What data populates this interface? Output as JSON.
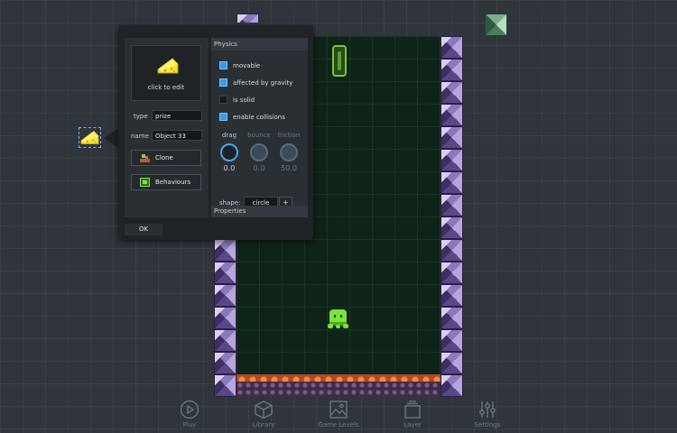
{
  "popup": {
    "edit_label": "click to edit",
    "type_label": "type",
    "type_value": "prize",
    "name_label": "name",
    "name_value": "Object 33",
    "clone_label": "Clone",
    "behaviours_label": "Behaviours",
    "ok_label": "OK",
    "physics": {
      "heading": "Physics",
      "checkboxes": [
        {
          "label": "movable",
          "checked": true
        },
        {
          "label": "affected by gravity",
          "checked": true
        },
        {
          "label": "is solid",
          "checked": false
        },
        {
          "label": "enable collisions",
          "checked": true
        }
      ],
      "dials": [
        {
          "title": "drag",
          "value": "0.0",
          "active": true
        },
        {
          "title": "bounce",
          "value": "0.0",
          "active": false
        },
        {
          "title": "friction",
          "value": "50.0",
          "active": false
        }
      ],
      "shape_label": "shape:",
      "shape_value": "circle",
      "shape_plus": "+"
    },
    "properties_heading": "Properties"
  },
  "toolbar": {
    "items": [
      {
        "label": "Play",
        "icon": "play-icon"
      },
      {
        "label": "Library",
        "icon": "cube-icon"
      },
      {
        "label": "Game Levels",
        "icon": "image-icon"
      },
      {
        "label": "Layer",
        "icon": "layers-icon"
      },
      {
        "label": "Settings",
        "icon": "sliders-icon"
      }
    ]
  },
  "colors": {
    "background": "#2f353b",
    "level": "#0f2418",
    "accent": "#3a9ae8",
    "popup": "#1f2326"
  }
}
